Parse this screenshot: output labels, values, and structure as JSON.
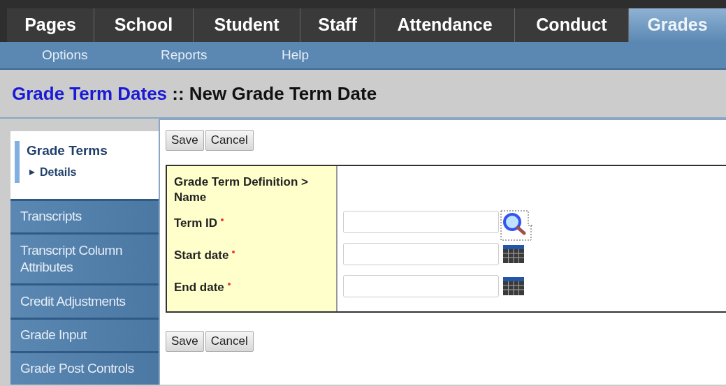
{
  "tabs": [
    {
      "label": "Pages",
      "selected": false
    },
    {
      "label": "School",
      "selected": false
    },
    {
      "label": "Student",
      "selected": false
    },
    {
      "label": "Staff",
      "selected": false
    },
    {
      "label": "Attendance",
      "selected": false
    },
    {
      "label": "Conduct",
      "selected": false
    },
    {
      "label": "Grades",
      "selected": true
    }
  ],
  "subnav": [
    "Options",
    "Reports",
    "Help"
  ],
  "title": {
    "link": "Grade Term Dates",
    "rest": ":: New Grade Term Date"
  },
  "sidebar": {
    "items": [
      {
        "label": "Grade Terms",
        "selected": true,
        "children": [
          {
            "label": "Details"
          }
        ]
      },
      {
        "label": "Transcripts",
        "selected": false
      },
      {
        "label": "Transcript Column Attributes",
        "selected": false
      },
      {
        "label": "Credit Adjustments",
        "selected": false
      },
      {
        "label": "Grade Input",
        "selected": false
      },
      {
        "label": "Grade Post Controls",
        "selected": false
      }
    ]
  },
  "top_buttons": [
    "Save",
    "Cancel"
  ],
  "form": {
    "heading": "Grade Term Definition > Name",
    "fields": [
      {
        "label": "Term ID",
        "required": true,
        "kind": "lookup"
      },
      {
        "label": "Start date",
        "required": true,
        "kind": "date"
      },
      {
        "label": "End date",
        "required": true,
        "kind": "date"
      }
    ]
  },
  "bottom_buttons": [
    "Save",
    "Cancel"
  ]
}
